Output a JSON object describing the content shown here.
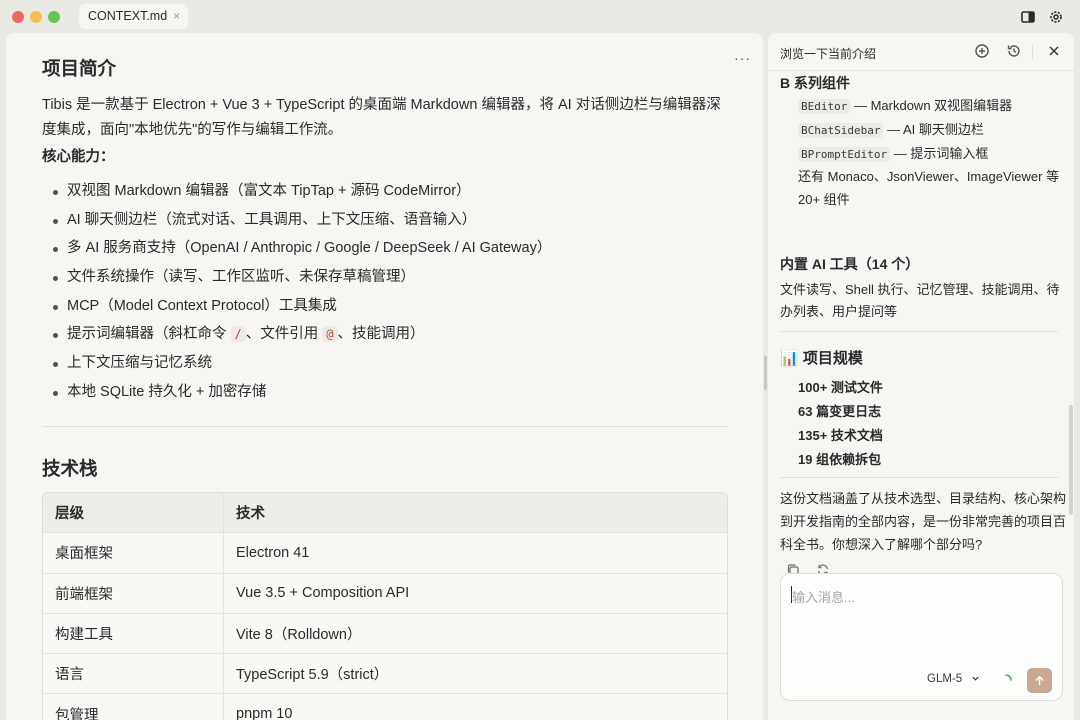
{
  "tab": {
    "title": "CONTEXT.md",
    "close": "×"
  },
  "editor": {
    "more": "···",
    "intro": {
      "heading": "项目简介",
      "text": "Tibis 是一款基于 Electron + Vue 3 + TypeScript 的桌面端 Markdown 编辑器，将 AI 对话侧边栏与编辑器深度集成，面向\"本地优先\"的写作与编辑工作流。",
      "core_label": "核心能力："
    },
    "features": [
      "双视图 Markdown 编辑器（富文本 TipTap + 源码 CodeMirror）",
      "AI 聊天侧边栏（流式对话、工具调用、上下文压缩、语音输入）",
      "多 AI 服务商支持（OpenAI / Anthropic / Google / DeepSeek / AI Gateway）",
      "文件系统操作（读写、工作区监听、未保存草稿管理）",
      "MCP（Model Context Protocol）工具集成",
      {
        "a": "提示词编辑器（斜杠命令 ",
        "code1": "/",
        "b": "、文件引用 ",
        "code2": "@",
        "c": "、技能调用）"
      },
      "上下文压缩与记忆系统",
      "本地 SQLite 持久化 + 加密存储"
    ],
    "tech": {
      "heading": "技术栈",
      "columns": [
        "层级",
        "技术"
      ],
      "rows": [
        [
          "桌面框架",
          "Electron 41"
        ],
        [
          "前端框架",
          "Vue 3.5 + Composition API"
        ],
        [
          "构建工具",
          "Vite 8（Rolldown）"
        ],
        [
          "语言",
          "TypeScript 5.9（strict）"
        ],
        [
          "包管理",
          "pnpm 10"
        ]
      ]
    }
  },
  "chat": {
    "title": "浏览一下当前介绍",
    "section_components": "B 系列组件",
    "components": [
      {
        "code": "BEditor",
        "desc": " — Markdown 双视图编辑器"
      },
      {
        "code": "BChatSidebar",
        "desc": " — AI 聊天侧边栏"
      },
      {
        "code": "BPromptEditor",
        "desc": " — 提示词输入框"
      }
    ],
    "components_more_1": "还有 Monaco、JsonViewer、ImageViewer 等",
    "components_more_2": "20+ 组件",
    "tools_heading": "内置 AI 工具（14 个）",
    "tools_text_1": "文件读写、Shell 执行、记忆管理、技能调用、待",
    "tools_text_2": "办列表、用户提问等",
    "scale_heading": "📊 项目规模",
    "scale_items": [
      "100+ 测试文件",
      "63 篇变更日志",
      "135+ 技术文档",
      "19 组依赖拆包"
    ],
    "summary_1": "这份文档涵盖了从技术选型、目录结构、核心架构",
    "summary_2": "到开发指南的全部内容，是一份非常完善的项目百",
    "summary_3": "科全书。你想深入了解哪个部分吗?",
    "input_placeholder": "输入消息...",
    "model": "GLM-5"
  },
  "icons": {
    "sidebar_toggle": "sidebar-icon",
    "settings": "gear-icon",
    "new_chat": "add-icon",
    "history": "history-icon",
    "close": "close-icon",
    "copy": "copy-icon",
    "regenerate": "refresh-icon",
    "send": "arrow-up-icon"
  },
  "colors": {
    "accent": "#c9a894",
    "code_text": "#c4463d"
  }
}
